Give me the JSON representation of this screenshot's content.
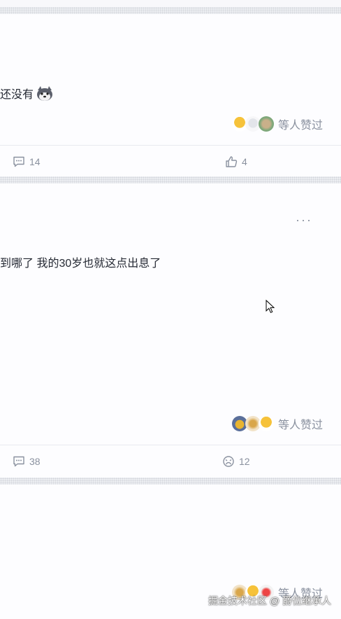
{
  "posts": [
    {
      "text": "还没有",
      "likes_text": "等人赞过",
      "comment_count": "14",
      "like_count": "4"
    },
    {
      "text": "到哪了 我的30岁也就这点出息了",
      "likes_text": "等人赞过",
      "comment_count": "38",
      "reaction_count": "12"
    },
    {
      "likes_text": "等人赞过"
    }
  ],
  "watermark": "掘金技术社区 @ 爵位继承人",
  "colors": {
    "muted": "#8a919f",
    "text": "#252933",
    "separator": "#eceef2"
  }
}
